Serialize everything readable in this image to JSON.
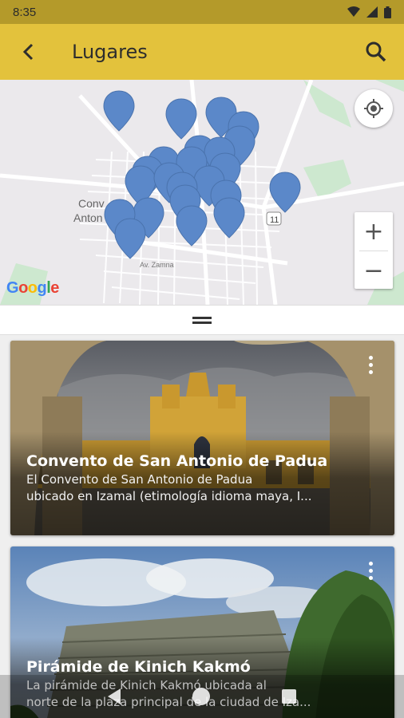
{
  "status_bar": {
    "time": "8:35"
  },
  "app_bar": {
    "title": "Lugares"
  },
  "map": {
    "labels": {
      "town_line1": "Conv",
      "town_line2": "Anton",
      "street": "Av. Zamna",
      "route": "11"
    },
    "attribution": "Google",
    "zoom_in": "+",
    "zoom_out": "−",
    "pin_color": "#5b88c9"
  },
  "places": [
    {
      "title": "Convento de San Antonio de Padua",
      "description_line1": "El Convento de San Antonio de Padua",
      "description_line2": "ubicado en Izamal (etimología idioma maya, I..."
    },
    {
      "title": "Pirámide de Kinich Kakmó",
      "description_line1": "La pirámide de Kinich Kakmó ubicada al",
      "description_line2": "norte de la plaza principal de la ciudad de Iza..."
    }
  ],
  "colors": {
    "app_bar": "#e3c23c",
    "status_bar": "#b49a2a"
  }
}
